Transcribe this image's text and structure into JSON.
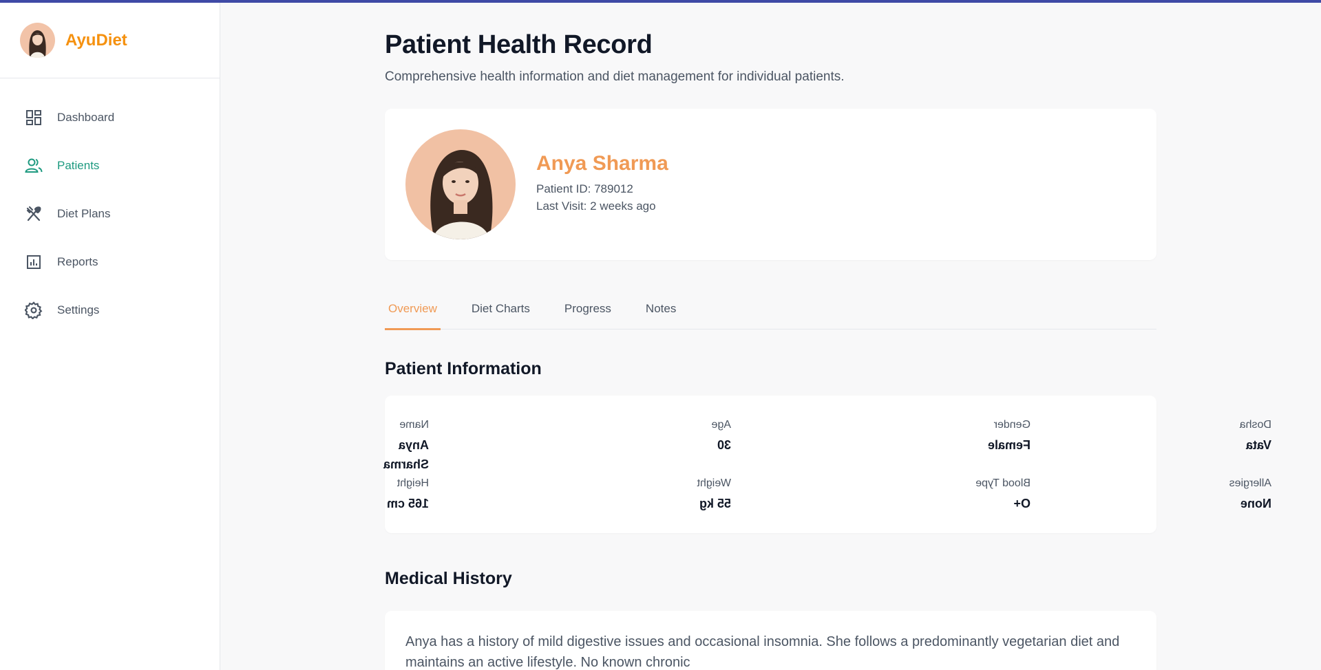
{
  "brand": {
    "name": "AyuDiet"
  },
  "sidebar": {
    "items": [
      {
        "label": "Dashboard",
        "icon": "dashboard-icon",
        "active": false
      },
      {
        "label": "Patients",
        "icon": "patients-icon",
        "active": true
      },
      {
        "label": "Diet Plans",
        "icon": "fork-knife-icon",
        "active": false
      },
      {
        "label": "Reports",
        "icon": "reports-icon",
        "active": false
      },
      {
        "label": "Settings",
        "icon": "gear-icon",
        "active": false
      }
    ]
  },
  "header": {
    "title": "Patient Health Record",
    "subtitle": "Comprehensive health information and diet management for individual patients."
  },
  "patient": {
    "name": "Anya Sharma",
    "id_text": "Patient ID: 789012",
    "last_visit": "Last Visit: 2 weeks ago"
  },
  "tabs": [
    {
      "label": "Overview",
      "active": true
    },
    {
      "label": "Diet Charts",
      "active": false
    },
    {
      "label": "Progress",
      "active": false
    },
    {
      "label": "Notes",
      "active": false
    }
  ],
  "patient_info": {
    "title": "Patient Information",
    "fields": {
      "name": {
        "label": "Name",
        "value": "Anya Sharma"
      },
      "age": {
        "label": "Age",
        "value": "30"
      },
      "gender": {
        "label": "Gender",
        "value": "Female"
      },
      "dosha": {
        "label": "Dosha",
        "value": "Vata"
      },
      "height": {
        "label": "Height",
        "value": "165 cm"
      },
      "weight": {
        "label": "Weight",
        "value": "55 kg"
      },
      "blood_type": {
        "label": "Blood Type",
        "value": "O+"
      },
      "allergies": {
        "label": "Allergies",
        "value": "None"
      }
    }
  },
  "medical_history": {
    "title": "Medical History",
    "text": "Anya has a history of mild digestive issues and occasional insomnia. She follows a predominantly vegetarian diet and maintains an active lifestyle. No known chronic"
  },
  "colors": {
    "accent_orange": "#f09a55",
    "brand_orange": "#f5910f",
    "active_green": "#1e9a80",
    "top_bar": "#3f4aa6"
  }
}
